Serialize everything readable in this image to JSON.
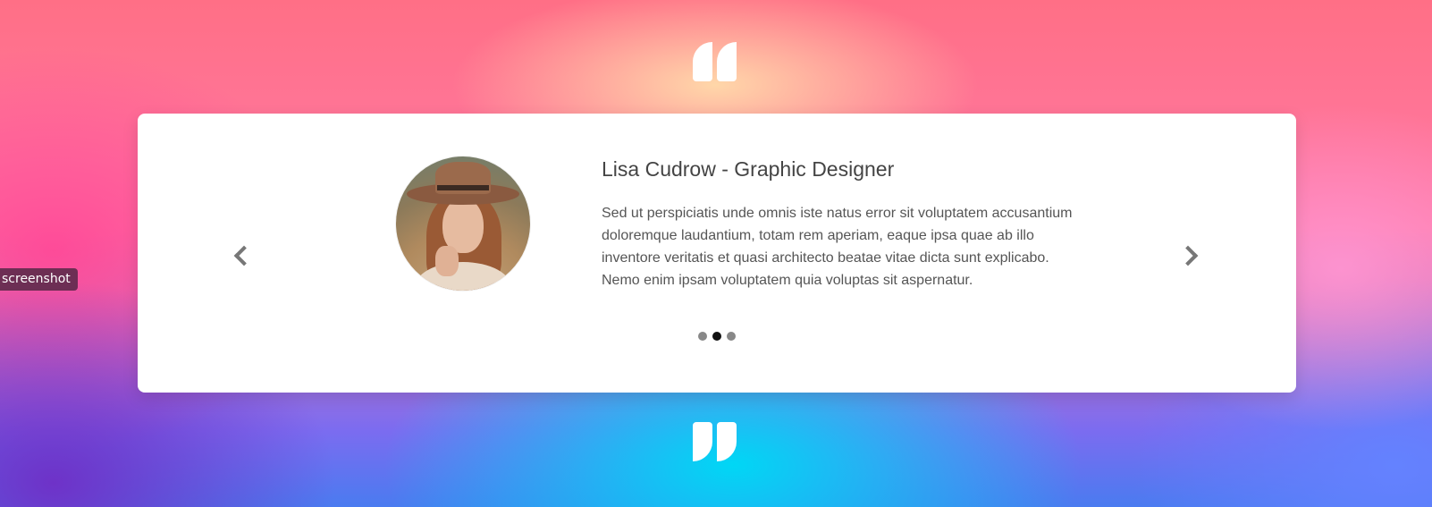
{
  "testimonial": {
    "name": "Lisa Cudrow - Graphic Designer",
    "text": "Sed ut perspiciatis unde omnis iste natus error sit voluptatem accusantium doloremque laudantium, totam rem aperiam, eaque ipsa quae ab illo inventore veritatis et quasi architecto beatae vitae dicta sunt explicabo. Nemo enim ipsam voluptatem quia voluptas sit aspernatur.",
    "avatar_icon": "woman-in-hat-portrait"
  },
  "carousel": {
    "prev_icon": "chevron-left-icon",
    "next_icon": "chevron-right-icon",
    "slides": 3,
    "active_slide": 2
  },
  "overlay": {
    "label": "screenshot"
  },
  "colors": {
    "card": "#ffffff",
    "heading": "#444444",
    "body": "#555555",
    "dot": "#888888",
    "dot_active": "#111111"
  }
}
